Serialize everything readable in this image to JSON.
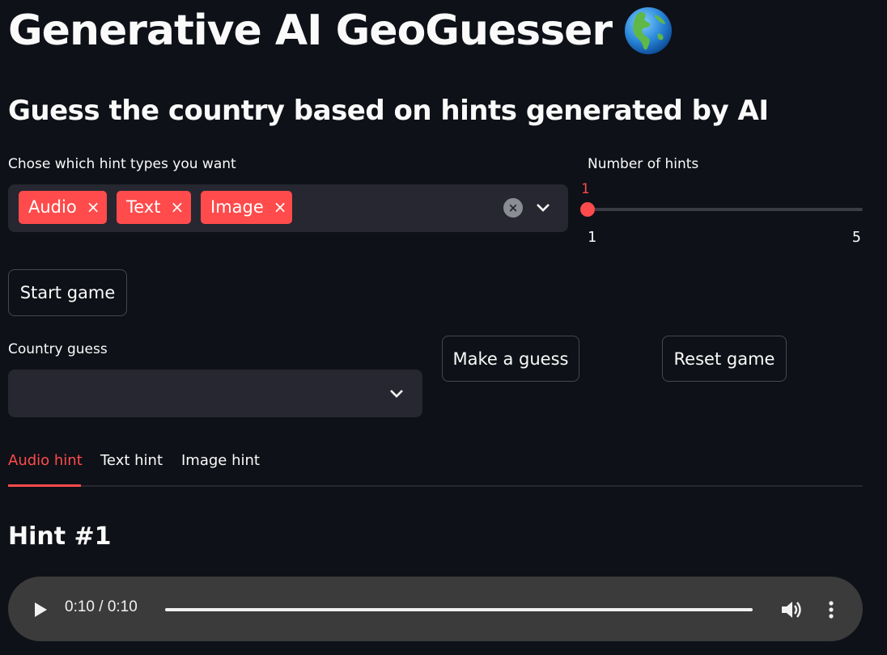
{
  "header": {
    "title": "Generative AI GeoGuesser",
    "title_icon": "earth-globe-americas-icon",
    "subtitle": "Guess the country based on hints generated by AI"
  },
  "hint_types": {
    "label": "Chose which hint types you want",
    "selected": [
      "Audio",
      "Text",
      "Image"
    ],
    "chip_remove_glyph": "×"
  },
  "num_hints": {
    "label": "Number of hints",
    "value": "1",
    "min_label": "1",
    "max_label": "5",
    "min": 1,
    "max": 5,
    "current": 1
  },
  "buttons": {
    "start_game": "Start game",
    "make_guess": "Make a guess",
    "reset_game": "Reset game"
  },
  "country_guess": {
    "label": "Country guess",
    "value": ""
  },
  "tabs": [
    {
      "label": "Audio hint",
      "active": true
    },
    {
      "label": "Text hint",
      "active": false
    },
    {
      "label": "Image hint",
      "active": false
    }
  ],
  "hint": {
    "title": "Hint #1",
    "audio": {
      "time_display": "0:10 / 0:10",
      "progress": 1.0
    }
  },
  "colors": {
    "background": "#0e1117",
    "accent": "#ff4b4b",
    "input_bg": "#262730",
    "player_bg": "#3b3b3b"
  }
}
